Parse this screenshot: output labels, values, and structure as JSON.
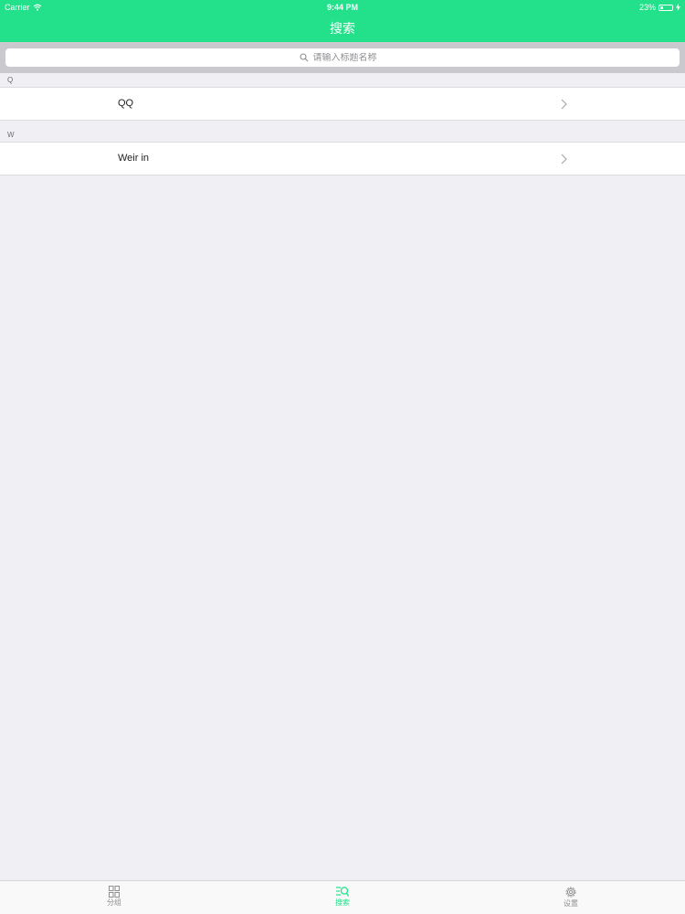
{
  "status_bar": {
    "carrier": "Carrier",
    "time": "9:44 PM",
    "battery": "23%",
    "battery_level": 0.23
  },
  "nav": {
    "title": "搜索"
  },
  "search": {
    "placeholder": "请输入标题名称"
  },
  "sections": [
    {
      "header": "Q",
      "items": [
        {
          "label": "QQ"
        }
      ]
    },
    {
      "header": "W",
      "items": [
        {
          "label": "Weir in"
        }
      ]
    }
  ],
  "tabbar": {
    "items": [
      {
        "label": "分组",
        "icon": "grid-icon",
        "active": false
      },
      {
        "label": "搜索",
        "icon": "search-list-icon",
        "active": true
      },
      {
        "label": "设置",
        "icon": "gear-icon",
        "active": false
      }
    ]
  },
  "colors": {
    "accent": "#22e18a",
    "background": "#efeff4",
    "search_bar_bg": "#c9c9ce",
    "inactive_tab": "#8e8e93"
  }
}
